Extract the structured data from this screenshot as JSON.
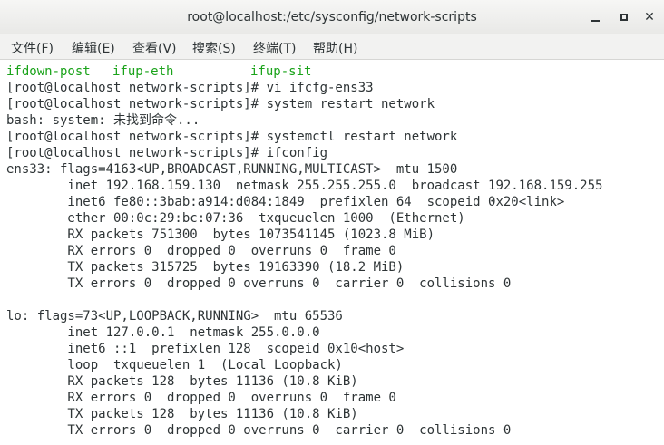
{
  "window": {
    "title": "root@localhost:/etc/sysconfig/network-scripts",
    "minimize_icon": "minimize-icon",
    "maximize_icon": "maximize-icon",
    "close_icon": "close-icon"
  },
  "menu": [
    {
      "label": "文件(F)"
    },
    {
      "label": "编辑(E)"
    },
    {
      "label": "查看(V)"
    },
    {
      "label": "搜索(S)"
    },
    {
      "label": "终端(T)"
    },
    {
      "label": "帮助(H)"
    }
  ],
  "terminal": {
    "ls_items": [
      "ifdown-post",
      "ifup-eth",
      "ifup-sit"
    ],
    "ls_color": "#1aa31a",
    "lines": [
      "[root@localhost network-scripts]# vi ifcfg-ens33",
      "[root@localhost network-scripts]# system restart network",
      "bash: system: 未找到命令...",
      "[root@localhost network-scripts]# systemctl restart network",
      "[root@localhost network-scripts]# ifconfig",
      "ens33: flags=4163<UP,BROADCAST,RUNNING,MULTICAST>  mtu 1500",
      "        inet 192.168.159.130  netmask 255.255.255.0  broadcast 192.168.159.255",
      "        inet6 fe80::3bab:a914:d084:1849  prefixlen 64  scopeid 0x20<link>",
      "        ether 00:0c:29:bc:07:36  txqueuelen 1000  (Ethernet)",
      "        RX packets 751300  bytes 1073541145 (1023.8 MiB)",
      "        RX errors 0  dropped 0  overruns 0  frame 0",
      "        TX packets 315725  bytes 19163390 (18.2 MiB)",
      "        TX errors 0  dropped 0 overruns 0  carrier 0  collisions 0",
      "",
      "lo: flags=73<UP,LOOPBACK,RUNNING>  mtu 65536",
      "        inet 127.0.0.1  netmask 255.0.0.0",
      "        inet6 ::1  prefixlen 128  scopeid 0x10<host>",
      "        loop  txqueuelen 1  (Local Loopback)",
      "        RX packets 128  bytes 11136 (10.8 KiB)",
      "        RX errors 0  dropped 0  overruns 0  frame 0",
      "        TX packets 128  bytes 11136 (10.8 KiB)",
      "        TX errors 0  dropped 0 overruns 0  carrier 0  collisions 0"
    ]
  }
}
